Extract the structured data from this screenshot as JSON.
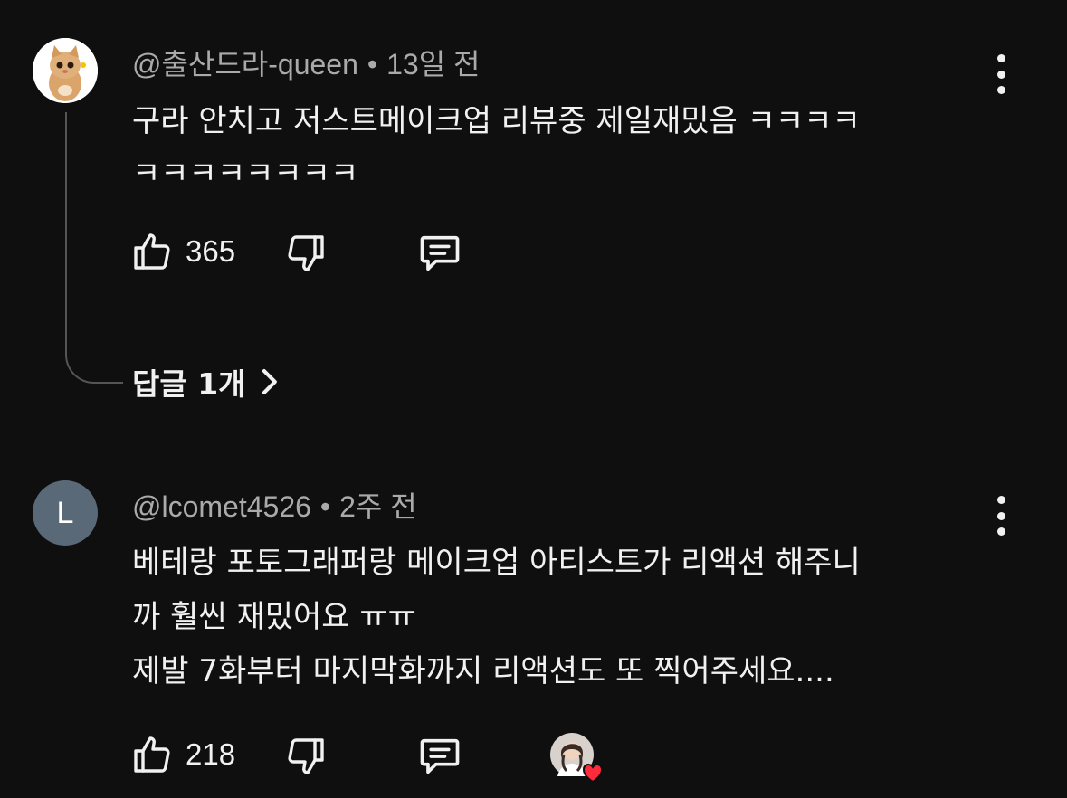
{
  "comments": [
    {
      "author": "@출산드라-queen",
      "age": "13일 전",
      "lines": [
        "구라 안치고 저스트메이크업 리뷰중 제일재밌음 ㅋㅋㅋㅋ",
        "ㅋㅋㅋㅋㅋㅋㅋㅋ"
      ],
      "likes": "365",
      "replies_label": "답글 1개"
    },
    {
      "author": "@lcomet4526",
      "avatar_letter": "L",
      "age": "2주 전",
      "lines": [
        "베테랑 포토그래퍼랑 메이크업 아티스트가 리액션 해주니",
        "까 훨씬 재밌어요 ㅠㅠ",
        "제발 7화부터 마지막화까지 리액션도 또 찍어주세요...."
      ],
      "likes": "218"
    }
  ],
  "separator": "•",
  "icons": {
    "like": "thumbs-up-icon",
    "dislike": "thumbs-down-icon",
    "reply": "comment-icon",
    "more": "kebab-menu-icon",
    "replies_arrow": "chevron-right-icon",
    "creator_heart": "heart-icon"
  },
  "colors": {
    "background": "#0f0f0f",
    "text": "#f1f1f1",
    "meta": "#aaaaaa",
    "heart": "#ff2b3d",
    "letter_avatar": "#5a6978"
  }
}
